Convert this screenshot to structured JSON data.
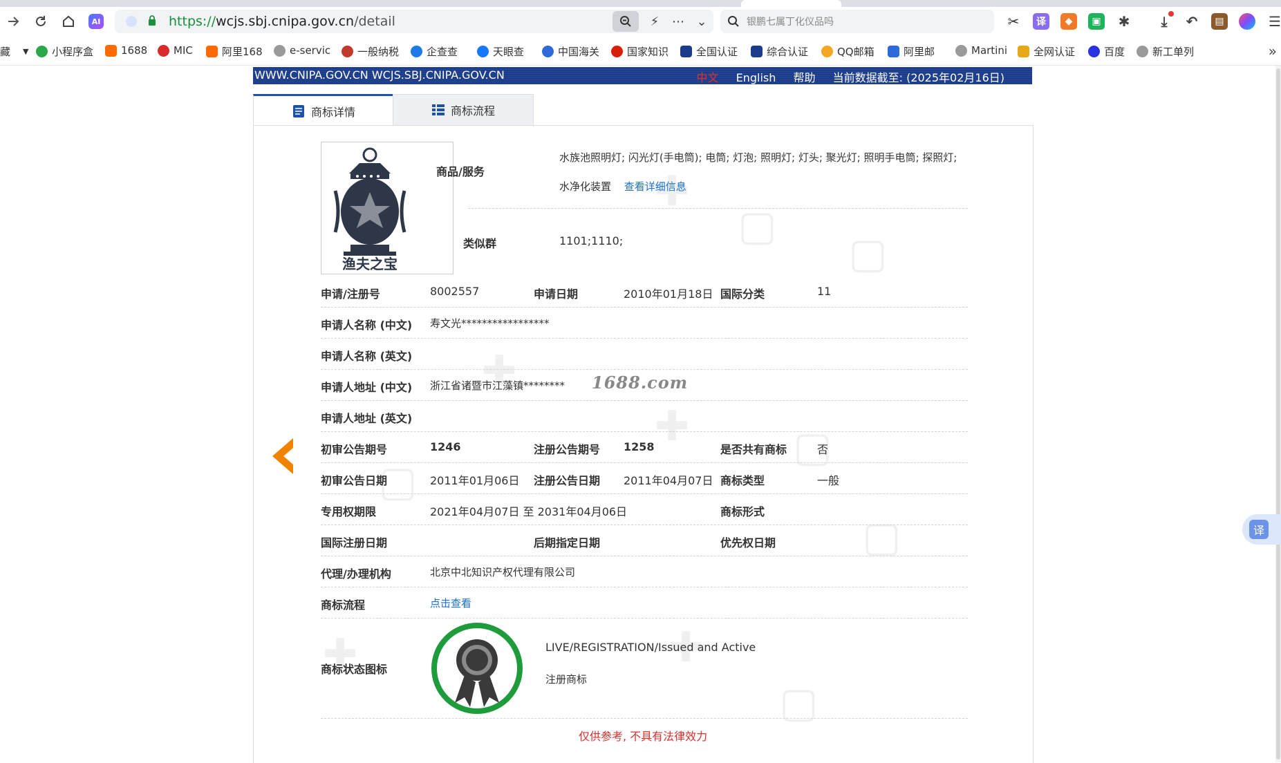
{
  "browser": {
    "url_scheme": "https://",
    "url_host": "wcjs.sbj.cnipa.gov.cn",
    "url_path": "/detail",
    "search_placeholder": "银鹏七属丁化仪品吗",
    "bookmarks": [
      {
        "label": "藏",
        "color": "#ffffff"
      },
      {
        "label": "小程序盒",
        "color": "#2aa84a"
      },
      {
        "label": "1688",
        "color": "#ff6a00"
      },
      {
        "label": "MIC",
        "color": "#d92b2b"
      },
      {
        "label": "阿里168",
        "color": "#ff6a00"
      },
      {
        "label": "e-servic",
        "color": "#9a9a9a"
      },
      {
        "label": "一般纳税",
        "color": "#c0392b"
      },
      {
        "label": "企查查",
        "color": "#1e7ae6"
      },
      {
        "label": "天眼查",
        "color": "#1677ff"
      },
      {
        "label": "中国海关",
        "color": "#2f6bd8"
      },
      {
        "label": "国家知识",
        "color": "#d81e06"
      },
      {
        "label": "全国认证",
        "color": "#1b3c8a"
      },
      {
        "label": "综合认证",
        "color": "#1b3c8a"
      },
      {
        "label": "QQ邮箱",
        "color": "#f5a623"
      },
      {
        "label": "阿里邮",
        "color": "#2f6bd8"
      },
      {
        "label": "Martini",
        "color": "#9a9a9a"
      },
      {
        "label": "全网认证",
        "color": "#e6a817"
      },
      {
        "label": "百度",
        "color": "#2932e1"
      },
      {
        "label": "新工单列",
        "color": "#9a9a9a"
      }
    ]
  },
  "header": {
    "domains": "WWW.CNIPA.GOV.CN WCJS.SBJ.CNIPA.GOV.CN",
    "lang_zh": "中文",
    "lang_en": "English",
    "help": "帮助",
    "data_date": "当前数据截至: (2025年02月16日)"
  },
  "tabs": {
    "detail": "商标详情",
    "process": "商标流程"
  },
  "logo": {
    "caption": "渔夫之宝"
  },
  "detail": {
    "goods_label": "商品/服务",
    "goods_line1": "水族池照明灯; 闪光灯(手电筒); 电筒; 灯泡; 照明灯; 灯头; 聚光灯; 照明手电筒; 探照灯;",
    "goods_line2": "水净化装置",
    "goods_link": "查看详细信息",
    "similar_label": "类似群",
    "similar_value": "1101;1110;",
    "reg_no_label": "申请/注册号",
    "reg_no": "8002557",
    "app_date_label": "申请日期",
    "app_date": "2010年01月18日",
    "intl_class_label": "国际分类",
    "intl_class": "11",
    "applicant_cn_label": "申请人名称 (中文)",
    "applicant_cn": "寿文光*****************",
    "applicant_en_label": "申请人名称 (英文)",
    "address_cn_label": "申请人地址 (中文)",
    "address_cn": "浙江省诸暨市江藻镇********",
    "address_en_label": "申请人地址 (英文)",
    "prelim_no_label": "初审公告期号",
    "prelim_no": "1246",
    "reg_pub_no_label": "注册公告期号",
    "reg_pub_no": "1258",
    "shared_label": "是否共有商标",
    "shared": "否",
    "prelim_date_label": "初审公告日期",
    "prelim_date": "2011年01月06日",
    "reg_pub_date_label": "注册公告日期",
    "reg_pub_date": "2011年04月07日",
    "type_label": "商标类型",
    "type": "一般",
    "term_label": "专用权期限",
    "term": "2021年04月07日 至 2031年04月06日",
    "form_label": "商标形式",
    "intl_reg_date_label": "国际注册日期",
    "later_desig_label": "后期指定日期",
    "priority_label": "优先权日期",
    "agent_label": "代理/办理机构",
    "agent": "北京中北知识产权代理有限公司",
    "process_label": "商标流程",
    "process_link": "点击查看",
    "status_label": "商标状态图标",
    "status_en": "LIVE/REGISTRATION/Issued and Active",
    "status_cn": "注册商标",
    "disclaimer": "仅供参考, 不具有法律效力"
  },
  "overlay_watermark": "1688.com",
  "translate_button": "译",
  "colors": {
    "header_blue": "#1b3c8a",
    "link_blue": "#1a6fd4",
    "status_green": "#1e9c3c",
    "disclaimer_red": "#d9302c",
    "arrow_orange": "#f08300"
  }
}
